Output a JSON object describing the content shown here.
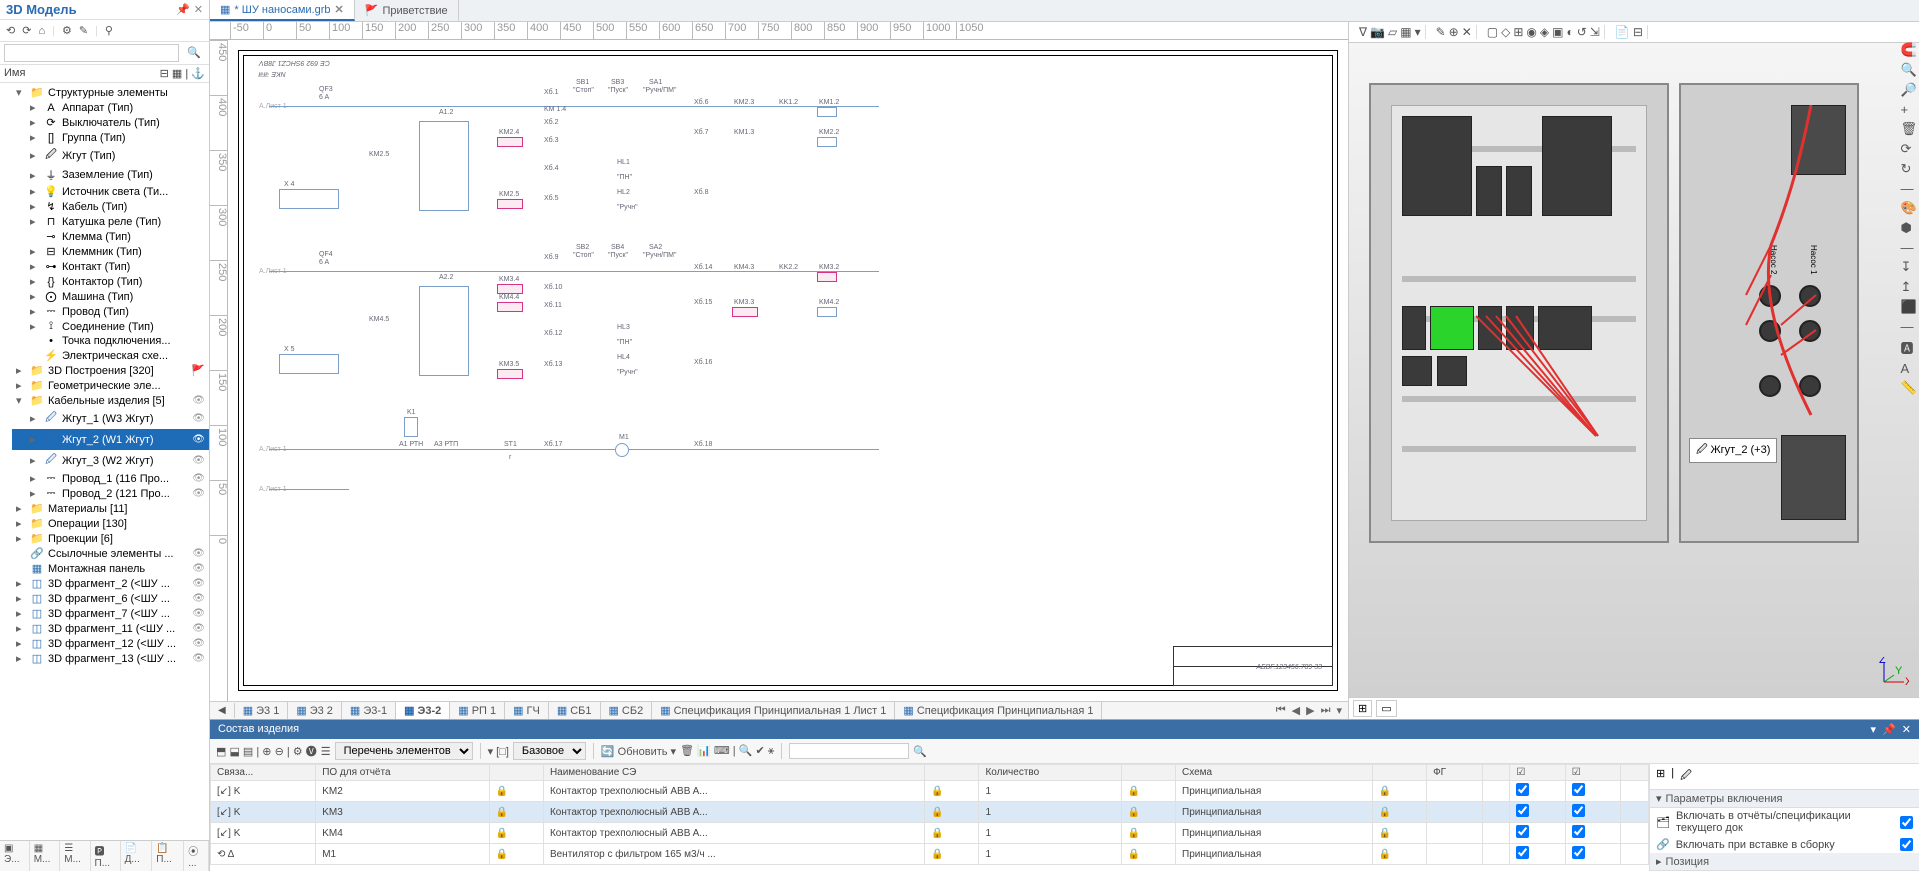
{
  "left_panel": {
    "title": "3D Модель",
    "pin_icon": "📌",
    "close_icon": "✕",
    "col_name": "Имя",
    "search_placeholder": "",
    "toolbar_icons": [
      "⟲",
      "⟳",
      "⌂",
      "|",
      "⚙",
      "✎",
      "|",
      "⚲"
    ],
    "tree": [
      {
        "tw": "▾",
        "ico": "📁",
        "label": "Структурные элементы",
        "cls": "folder-ico"
      },
      {
        "tw": "▸",
        "ico": "А",
        "label": "Аппарат (Тип)",
        "indent": 1
      },
      {
        "tw": "▸",
        "ico": "⟳",
        "label": "Выключатель (Тип)",
        "indent": 1
      },
      {
        "tw": "▸",
        "ico": "[]",
        "label": "Группа (Тип)",
        "indent": 1
      },
      {
        "tw": "▸",
        "ico": "🖉",
        "label": "Жгут (Тип)",
        "indent": 1
      },
      {
        "tw": "▸",
        "ico": "⏚",
        "label": "Заземление (Тип)",
        "indent": 1
      },
      {
        "tw": "▸",
        "ico": "💡",
        "label": "Источник света (Ти...",
        "indent": 1
      },
      {
        "tw": "▸",
        "ico": "↯",
        "label": "Кабель (Тип)",
        "indent": 1
      },
      {
        "tw": "▸",
        "ico": "⊓",
        "label": "Катушка реле (Тип)",
        "indent": 1
      },
      {
        "tw": "",
        "ico": "⊸",
        "label": "Клемма (Тип)",
        "indent": 1
      },
      {
        "tw": "▸",
        "ico": "⊟",
        "label": "Клеммник (Тип)",
        "indent": 1
      },
      {
        "tw": "▸",
        "ico": "⊶",
        "label": "Контакт (Тип)",
        "indent": 1
      },
      {
        "tw": "▸",
        "ico": "{}",
        "label": "Контактор (Тип)",
        "indent": 1
      },
      {
        "tw": "▸",
        "ico": "⨀",
        "label": "Машина (Тип)",
        "indent": 1
      },
      {
        "tw": "▸",
        "ico": "⎓",
        "label": "Провод (Тип)",
        "indent": 1
      },
      {
        "tw": "▸",
        "ico": "⟟",
        "label": "Соединение (Тип)",
        "indent": 1
      },
      {
        "tw": "",
        "ico": "•",
        "label": "Точка подключения...",
        "indent": 1
      },
      {
        "tw": "",
        "ico": "⚡",
        "label": "Электрическая схе...",
        "indent": 1
      },
      {
        "tw": "▸",
        "ico": "📁",
        "label": "3D Построения [320]",
        "cls": "folder-ico",
        "extra": "🚩"
      },
      {
        "tw": "▸",
        "ico": "📁",
        "label": "Геометрические эле...",
        "cls": "folder-ico"
      },
      {
        "tw": "▾",
        "ico": "📁",
        "label": "Кабельные изделия [5]",
        "cls": "folder-ico",
        "eye": "👁"
      },
      {
        "tw": "▸",
        "ico": "🖉",
        "label": "Жгут_1 (W3 Жгут)",
        "indent": 1,
        "cls": "blue-ico",
        "eye": "👁"
      },
      {
        "tw": "▸",
        "ico": "🖉",
        "label": "Жгут_2 (W1 Жгут)",
        "indent": 1,
        "cls": "blue-ico",
        "eye": "👁",
        "selected": true
      },
      {
        "tw": "▸",
        "ico": "🖉",
        "label": "Жгут_3 (W2 Жгут)",
        "indent": 1,
        "cls": "blue-ico",
        "eye": "👁"
      },
      {
        "tw": "▸",
        "ico": "⎓",
        "label": "Провод_1 (116 Про...",
        "indent": 1,
        "eye": "👁"
      },
      {
        "tw": "▸",
        "ico": "⎓",
        "label": "Провод_2 (121 Про...",
        "indent": 1,
        "eye": "👁"
      },
      {
        "tw": "▸",
        "ico": "📁",
        "label": "Материалы [11]",
        "cls": "folder-ico"
      },
      {
        "tw": "▸",
        "ico": "📁",
        "label": "Операции [130]",
        "cls": "folder-ico"
      },
      {
        "tw": "▸",
        "ico": "📁",
        "label": "Проекции [6]",
        "cls": "folder-ico"
      },
      {
        "tw": "",
        "ico": "🔗",
        "label": "Ссылочные элементы ...",
        "cls": "blue-ico",
        "eye": "👁"
      },
      {
        "tw": "",
        "ico": "▦",
        "label": "Монтажная панель",
        "cls": "blue-ico",
        "eye": "👁"
      },
      {
        "tw": "▸",
        "ico": "◫",
        "label": "3D фрагмент_2 (<ШУ ...",
        "cls": "blue-ico",
        "eye": "👁"
      },
      {
        "tw": "▸",
        "ico": "◫",
        "label": "3D фрагмент_6 (<ШУ ...",
        "cls": "blue-ico",
        "eye": "👁"
      },
      {
        "tw": "▸",
        "ico": "◫",
        "label": "3D фрагмент_7 (<ШУ ...",
        "cls": "blue-ico",
        "eye": "👁"
      },
      {
        "tw": "▸",
        "ico": "◫",
        "label": "3D фрагмент_11 (<ШУ ...",
        "cls": "blue-ico",
        "eye": "👁"
      },
      {
        "tw": "▸",
        "ico": "◫",
        "label": "3D фрагмент_12 (<ШУ ...",
        "cls": "blue-ico",
        "eye": "👁"
      },
      {
        "tw": "▸",
        "ico": "◫",
        "label": "3D фрагмент_13 (<ШУ ...",
        "cls": "blue-ico",
        "eye": "👁"
      }
    ],
    "bottom_tabs": [
      "▣ Э...",
      "▦ М...",
      "☰ М...",
      "🅿 П...",
      "📄 Д...",
      "📋 П...",
      "⦿ ..."
    ]
  },
  "file_tabs": [
    {
      "label": "* ШУ наносами.grb",
      "active": true,
      "closable": true
    },
    {
      "label": "Приветствие",
      "active": false,
      "closable": false,
      "flag": true
    }
  ],
  "ruler_h": [
    "-50",
    "0",
    "50",
    "100",
    "150",
    "200",
    "250",
    "300",
    "350",
    "400",
    "450",
    "500",
    "550",
    "600",
    "650",
    "700",
    "750",
    "800",
    "850",
    "900",
    "950",
    "1000",
    "1050"
  ],
  "ruler_v": [
    "450",
    "400",
    "350",
    "300",
    "250",
    "200",
    "150",
    "100",
    "50",
    "0"
  ],
  "schematic_labels": {
    "frame_tl": "CE 692 9SHCZ1 J8BV",
    "frame_tl2": "NKE जज",
    "qf3": "QF3",
    "qf3_a": "6 A",
    "qf4": "QF4",
    "qf4_a": "6 A",
    "a12": "A1.2",
    "a22": "A2.2",
    "x4": "X 4",
    "x5": "X 5",
    "km25": "KM2.5",
    "km24": "KM2.4",
    "km14": "KM 1.4",
    "km45": "KM4.5",
    "km44": "KM4.4",
    "km34": "KM3.4",
    "km35": "KM3.5",
    "km2_5b": "KM2.5",
    "sb1": "SB1",
    "sb1_t": "\"Стоп\"",
    "sb3": "SB3",
    "sb3_t": "\"Пуск\"",
    "sa1": "SA1",
    "sa1_t": "\"Ручн/ПМ\"",
    "sb2": "SB2",
    "sb2_t": "\"Стоп\"",
    "sb4": "SB4",
    "sb4_t": "\"Пуск\"",
    "sa2": "SA2",
    "sa2_t": "\"Ручн/ПМ\"",
    "xb1": "Xб.1",
    "xb2": "Xб.2",
    "xb3": "Xб.3",
    "xb4": "Xб.4",
    "xb5": "Xб.5",
    "xb6": "Xб.6",
    "xb7": "Xб.7",
    "xb8": "Xб.8",
    "xb9": "Xб.9",
    "xb10": "Xб.10",
    "xb11": "Xб.11",
    "xb12": "Xб.12",
    "xb13": "Xб.13",
    "xb14": "Xб.14",
    "xb15": "Xб.15",
    "xb16": "Xб.16",
    "xb17": "Xб.17",
    "xb18": "Xб.18",
    "km23": "KM2.3",
    "km13": "KM1.3",
    "kk12": "KK1.2",
    "km12": "KM1.2",
    "km22": "KM2.2",
    "km43": "KM4.3",
    "km33": "KM3.3",
    "kk22": "KK2.2",
    "km32": "KM3.2",
    "km42": "KM4.2",
    "hl1": "HL1",
    "hl1_t": "\"ПН\"",
    "hl2": "HL2",
    "hl2_t": "\"Ручн\"",
    "hl3": "HL3",
    "hl3_t": "\"ПН\"",
    "hl4": "HL4",
    "hl4_t": "\"Ручн\"",
    "k1": "K1",
    "a1p": "A1 РТН",
    "a3p": "A3 РТП",
    "st1": "ST1",
    "r": "r",
    "m1": "M1",
    "draw_no": "АБВГ.123456.789 33",
    "a_line_l": "А.Лист 1",
    "a_line_r": "А.Лист 1"
  },
  "sheet_tabs": [
    "Э3 1",
    "Э3 2",
    "Э3-1",
    "Э3-2",
    "РП 1",
    "ГЧ",
    "СБ1",
    "СБ2",
    "Спецификация Принципиальная 1 Лист 1",
    "Спецификация Принципиальная 1"
  ],
  "sheet_active": 3,
  "d3_toolbar_groups": [
    [
      "∇",
      "📷",
      "▱",
      "▦",
      "▾"
    ],
    [
      "✎",
      "⊕",
      "✕"
    ],
    [
      "▢",
      "◇",
      "⊞",
      "◉",
      "◈",
      "▣",
      "◐",
      "↺",
      "⇲"
    ],
    [
      "📄",
      "⊟"
    ]
  ],
  "d3_right_icons": [
    "🧲",
    "🔍",
    "🔎",
    "+",
    "🗑",
    "⟳",
    "↻",
    "—",
    "🎨",
    "⬢",
    "—",
    "↧",
    "↥",
    "⬛",
    "—",
    "🅰",
    "Α",
    "📏"
  ],
  "d3_callout": "Жгут_2 (+3)",
  "d3_callout_ico": "🖉",
  "d3_bottom": [
    "⊞",
    "▭"
  ],
  "coord_axes": {
    "x": "X",
    "y": "Y",
    "z": "Z"
  },
  "cabinet_door_labels": {
    "l1": "Насос 1",
    "l2": "Насос 2"
  },
  "bottom_panel": {
    "title": "Состав изделия",
    "header_ctrls": [
      "▾",
      "📌",
      "✕"
    ],
    "toolbar": {
      "icons1": [
        "⬒",
        "⬓",
        "▤",
        "|",
        "⊕",
        "⊖",
        "|",
        "⚙",
        "🅥"
      ],
      "list_type": "Перечень элементов",
      "base": "Базовое",
      "refresh": "Обновить",
      "icons2": [
        "🗑",
        "📊",
        "⌨",
        "|",
        "🔍",
        "✔",
        "⚹"
      ]
    },
    "search": "",
    "right_toolbar": [
      "⊞",
      "|",
      "🖉"
    ],
    "right_section_title": "Параметры включения",
    "props": [
      {
        "ico": "🗂",
        "label": "Включать в отчёты/спецификации текущего док",
        "chk": true
      },
      {
        "ico": "🔗",
        "label": "Включать при вставке в сборку",
        "chk": true
      }
    ],
    "last_row": "Позиция",
    "table": {
      "columns": [
        "Связа...",
        "ПО для отчёта",
        "",
        "Наименование СЭ",
        "",
        "Количество",
        "",
        "Схема",
        "",
        "ФГ",
        "",
        "☑",
        "☑",
        ""
      ],
      "rows": [
        {
          "c": [
            "[↙] K",
            "KM2",
            "🔒",
            "Контактор трехполюсный ABB A...",
            "🔒",
            "1",
            "🔒",
            "Принципиальная",
            "🔒",
            "",
            "",
            "☑",
            "☑",
            ""
          ]
        },
        {
          "c": [
            "[↙] K",
            "KM3",
            "🔒",
            "Контактор трехполюсный ABB A...",
            "🔒",
            "1",
            "🔒",
            "Принципиальная",
            "🔒",
            "",
            "",
            "☑",
            "☑",
            ""
          ],
          "sel": true
        },
        {
          "c": [
            "[↙] K",
            "KM4",
            "🔒",
            "Контактор трехполюсный ABB A...",
            "🔒",
            "1",
            "🔒",
            "Принципиальная",
            "🔒",
            "",
            "",
            "☑",
            "☑",
            ""
          ]
        },
        {
          "c": [
            "⟲ Δ",
            "M1",
            "🔒",
            "Вентилятор с фильтром 165 м3/ч ...",
            "🔒",
            "1",
            "🔒",
            "Принципиальная",
            "🔒",
            "",
            "",
            "☑",
            "☑",
            ""
          ]
        }
      ]
    }
  }
}
